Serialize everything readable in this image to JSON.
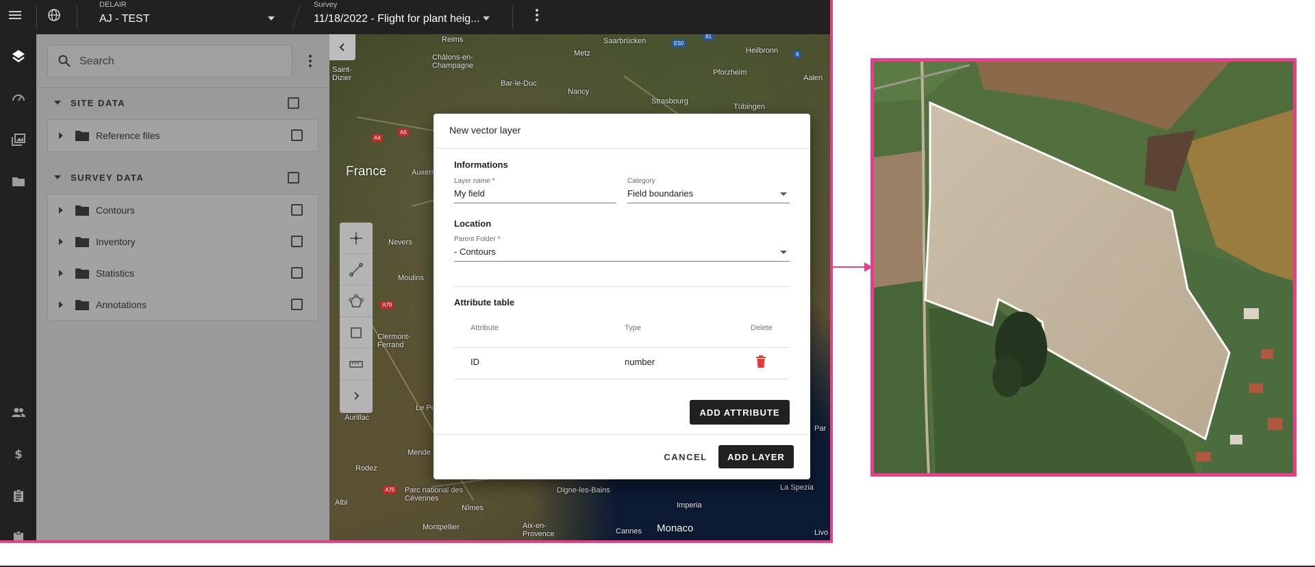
{
  "topbar": {
    "menu_icon": "hamburger-menu-icon",
    "globe_icon": "globe-icon",
    "project": {
      "caption": "DELAIR",
      "value": "AJ - TEST"
    },
    "survey": {
      "caption": "Survey",
      "value": "11/18/2022 - Flight for plant heig..."
    },
    "more_icon": "more-vertical-icon"
  },
  "rail": [
    "layers-icon",
    "gauge-icon",
    "gallery-icon",
    "folder-icon",
    "users-icon",
    "dollar-icon",
    "clipboard-icon",
    "clipboard-icon"
  ],
  "panel": {
    "search_placeholder": "Search",
    "sections": [
      {
        "label": "SITE DATA",
        "items": [
          "Reference files"
        ]
      },
      {
        "label": "SURVEY DATA",
        "items": [
          "Contours",
          "Inventory",
          "Statistics",
          "Annotations"
        ]
      }
    ]
  },
  "map": {
    "places": [
      "Reims",
      "Châlons-en-Champagne",
      "Saarbrücken",
      "Metz",
      "Heilbronn",
      "Pforzheim",
      "Bar-le-Duc",
      "Nancy",
      "Strasbourg",
      "Tübingen",
      "Aalen",
      "Saint-Dizier",
      "France",
      "Auxerre",
      "Nevers",
      "Moulins",
      "Clermont-Ferrand",
      "Aurillac",
      "Le Puy",
      "Mende",
      "Rodez",
      "Parc national des Cévennes",
      "Albi",
      "Nîmes",
      "Digne-les-Bains",
      "Imperia",
      "La Spezia",
      "Montpellier",
      "Aix-en-Provence",
      "Cannes",
      "Monaco",
      "Livo",
      "Par"
    ],
    "road_shields": [
      "A4",
      "A5",
      "A75",
      "A79",
      "E50",
      "6",
      "81"
    ]
  },
  "dialog": {
    "title": "New vector layer",
    "informations_title": "Informations",
    "layer_name_label": "Layer name *",
    "layer_name_value": "My field",
    "category_label": "Category",
    "category_value": "Field boundaries",
    "location_title": "Location",
    "parent_folder_label": "Parent Folder *",
    "parent_folder_value": "- Contours",
    "attribute_table_title": "Attribute table",
    "columns": {
      "attribute": "Attribute",
      "type": "Type",
      "delete": "Delete"
    },
    "rows": [
      {
        "attribute": "ID",
        "type": "number"
      }
    ],
    "add_attribute": "ADD ATTRIBUTE",
    "cancel": "CANCEL",
    "add_layer": "ADD LAYER"
  },
  "colors": {
    "highlight": "#e83e8c",
    "delete": "#e53935",
    "dark": "#212121"
  }
}
